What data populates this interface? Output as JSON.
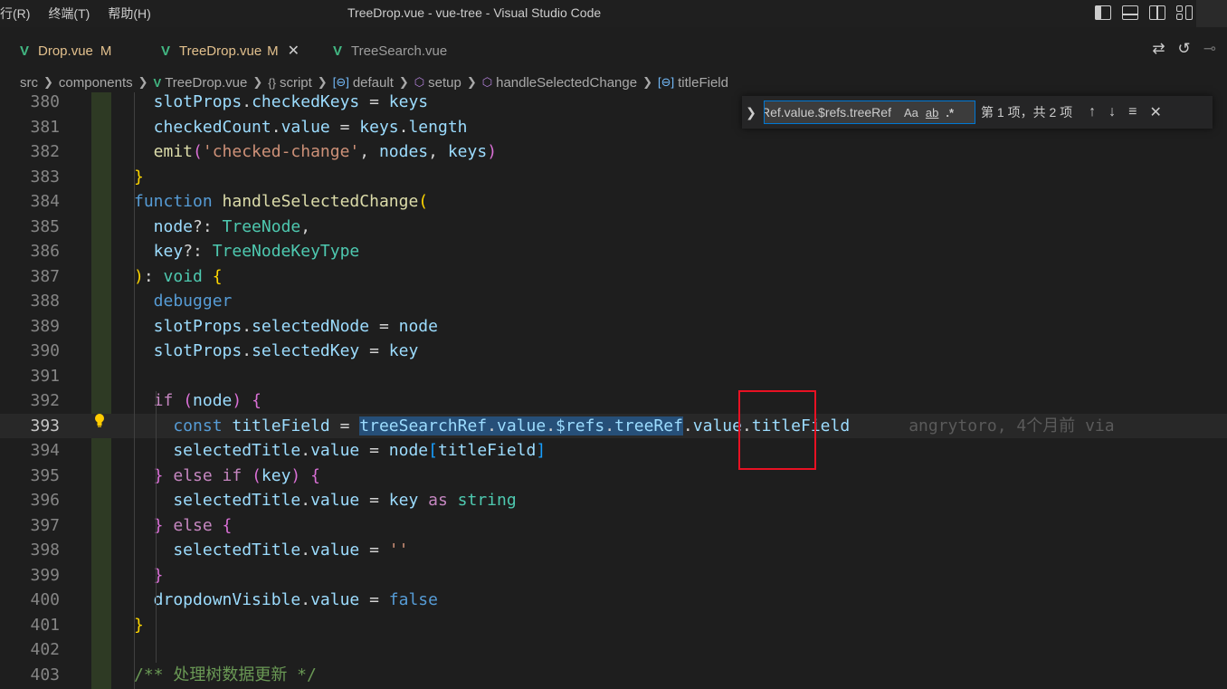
{
  "titlebar": {
    "menus": [
      "行(R)",
      "终端(T)",
      "帮助(H)"
    ],
    "title": "TreeDrop.vue - vue-tree - Visual Studio Code"
  },
  "tabs": [
    {
      "name": "Drop.vue",
      "badge": "M",
      "active": false,
      "vue_icon": "V"
    },
    {
      "name": "TreeDrop.vue",
      "badge": "M",
      "active": true,
      "close": "✕",
      "vue_icon": "V"
    },
    {
      "name": "TreeSearch.vue",
      "badge": "",
      "active": false,
      "vue_icon": "V"
    }
  ],
  "breadcrumb": {
    "items": [
      "src",
      "components",
      "TreeDrop.vue",
      "script",
      "default",
      "setup",
      "handleSelectedChange",
      "titleField"
    ],
    "script_prefix": "{}"
  },
  "find": {
    "value": "Ref.value.$refs.treeRef",
    "opt_case": "Aa",
    "opt_word": "ab",
    "opt_regex": ".*",
    "result": "第 1 项，共 2 项"
  },
  "blame": "angrytoro, 4个月前 via",
  "lines": [
    {
      "num": "380",
      "tokens": [
        [
          "var",
          "  slotProps"
        ],
        [
          "pun",
          "."
        ],
        [
          "var",
          "checkedKeys"
        ],
        [
          "pun",
          " = "
        ],
        [
          "var",
          "keys"
        ]
      ]
    },
    {
      "num": "381",
      "tokens": [
        [
          "var",
          "  checkedCount"
        ],
        [
          "pun",
          "."
        ],
        [
          "var",
          "value"
        ],
        [
          "pun",
          " = "
        ],
        [
          "var",
          "keys"
        ],
        [
          "pun",
          "."
        ],
        [
          "var",
          "length"
        ]
      ]
    },
    {
      "num": "382",
      "tokens": [
        [
          "fn",
          "  emit"
        ],
        [
          "brk2",
          "("
        ],
        [
          "str",
          "'checked-change'"
        ],
        [
          "pun",
          ", "
        ],
        [
          "var",
          "nodes"
        ],
        [
          "pun",
          ", "
        ],
        [
          "var",
          "keys"
        ],
        [
          "brk2",
          ")"
        ]
      ]
    },
    {
      "num": "383",
      "tokens": [
        [
          "brk1",
          "}"
        ]
      ]
    },
    {
      "num": "384",
      "tokens": [
        [
          "kw",
          "function "
        ],
        [
          "fn",
          "handleSelectedChange"
        ],
        [
          "brk1",
          "("
        ]
      ]
    },
    {
      "num": "385",
      "tokens": [
        [
          "var",
          "  node"
        ],
        [
          "pun",
          "?: "
        ],
        [
          "typ",
          "TreeNode"
        ],
        [
          "pun",
          ","
        ]
      ]
    },
    {
      "num": "386",
      "tokens": [
        [
          "var",
          "  key"
        ],
        [
          "pun",
          "?: "
        ],
        [
          "typ",
          "TreeNodeKeyType"
        ]
      ]
    },
    {
      "num": "387",
      "tokens": [
        [
          "brk1",
          ")"
        ],
        [
          "pun",
          ": "
        ],
        [
          "typ",
          "void "
        ],
        [
          "brk1",
          "{"
        ]
      ]
    },
    {
      "num": "388",
      "tokens": [
        [
          "kw",
          "  debugger"
        ]
      ]
    },
    {
      "num": "389",
      "tokens": [
        [
          "var",
          "  slotProps"
        ],
        [
          "pun",
          "."
        ],
        [
          "var",
          "selectedNode"
        ],
        [
          "pun",
          " = "
        ],
        [
          "var",
          "node"
        ]
      ]
    },
    {
      "num": "390",
      "tokens": [
        [
          "var",
          "  slotProps"
        ],
        [
          "pun",
          "."
        ],
        [
          "var",
          "selectedKey"
        ],
        [
          "pun",
          " = "
        ],
        [
          "var",
          "key"
        ]
      ]
    },
    {
      "num": "391",
      "tokens": []
    },
    {
      "num": "392",
      "tokens": [
        [
          "kw2",
          "  if "
        ],
        [
          "brk2",
          "("
        ],
        [
          "var",
          "node"
        ],
        [
          "brk2",
          ") {"
        ]
      ]
    },
    {
      "num": "393",
      "tokens": [
        [
          "kw",
          "    const "
        ],
        [
          "var",
          "titleField"
        ],
        [
          "pun",
          " = "
        ],
        [
          "selvar",
          "treeSearchRef"
        ],
        [
          "selpun",
          "."
        ],
        [
          "selvar",
          "value"
        ],
        [
          "selpun",
          "."
        ],
        [
          "selvar",
          "$refs"
        ],
        [
          "selpun",
          "."
        ],
        [
          "selvar",
          "treeRef"
        ],
        [
          "pun",
          "."
        ],
        [
          "var",
          "value"
        ],
        [
          "pun",
          "."
        ],
        [
          "var",
          "titleField"
        ]
      ]
    },
    {
      "num": "394",
      "tokens": [
        [
          "var",
          "    selectedTitle"
        ],
        [
          "pun",
          "."
        ],
        [
          "var",
          "value"
        ],
        [
          "pun",
          " = "
        ],
        [
          "var",
          "node"
        ],
        [
          "brk3",
          "["
        ],
        [
          "var",
          "titleField"
        ],
        [
          "brk3",
          "]"
        ]
      ]
    },
    {
      "num": "395",
      "tokens": [
        [
          "brk2",
          "  } "
        ],
        [
          "kw2",
          "else if "
        ],
        [
          "brk2",
          "("
        ],
        [
          "var",
          "key"
        ],
        [
          "brk2",
          ") {"
        ]
      ]
    },
    {
      "num": "396",
      "tokens": [
        [
          "var",
          "    selectedTitle"
        ],
        [
          "pun",
          "."
        ],
        [
          "var",
          "value"
        ],
        [
          "pun",
          " = "
        ],
        [
          "var",
          "key "
        ],
        [
          "kw2",
          "as "
        ],
        [
          "typ",
          "string"
        ]
      ]
    },
    {
      "num": "397",
      "tokens": [
        [
          "brk2",
          "  } "
        ],
        [
          "kw2",
          "else "
        ],
        [
          "brk2",
          "{"
        ]
      ]
    },
    {
      "num": "398",
      "tokens": [
        [
          "var",
          "    selectedTitle"
        ],
        [
          "pun",
          "."
        ],
        [
          "var",
          "value"
        ],
        [
          "pun",
          " = "
        ],
        [
          "str",
          "''"
        ]
      ]
    },
    {
      "num": "399",
      "tokens": [
        [
          "brk2",
          "  }"
        ]
      ]
    },
    {
      "num": "400",
      "tokens": [
        [
          "var",
          "  dropdownVisible"
        ],
        [
          "pun",
          "."
        ],
        [
          "var",
          "value"
        ],
        [
          "pun",
          " = "
        ],
        [
          "kw",
          "false"
        ]
      ]
    },
    {
      "num": "401",
      "tokens": [
        [
          "brk1",
          "}"
        ]
      ]
    },
    {
      "num": "402",
      "tokens": []
    },
    {
      "num": "403",
      "tokens": [
        [
          "cmt",
          "/** 处理树数据更新 */"
        ]
      ]
    }
  ]
}
